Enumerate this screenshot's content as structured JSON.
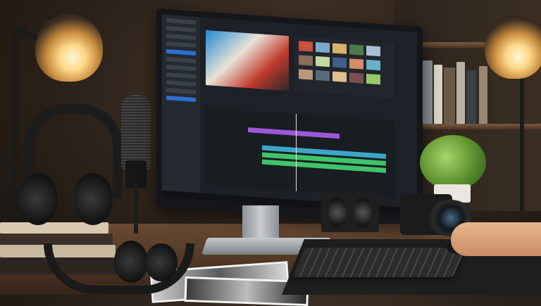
{
  "scene": {
    "subject": "video-editing-desk",
    "palette": {
      "wall": "#2b2119",
      "lamp_glow": "#ffd88a",
      "screen_bg": "#1d2127",
      "accent_blue": "#2e6fd1",
      "clip_purple": "#9b59d6",
      "clip_green": "#3ec46a",
      "clip_teal": "#3aa7c9",
      "desk_wood": "#6a4b33"
    }
  },
  "icons": {
    "desk_lamp_left": "lamp-icon",
    "desk_lamp_right": "lamp-icon",
    "microphone": "microphone-icon",
    "headphones": "headphones-icon",
    "camera": "camera-icon",
    "speaker": "speaker-icon",
    "keyboard": "keyboard-icon",
    "mouse": "mouse-icon",
    "plant": "plant-icon"
  }
}
